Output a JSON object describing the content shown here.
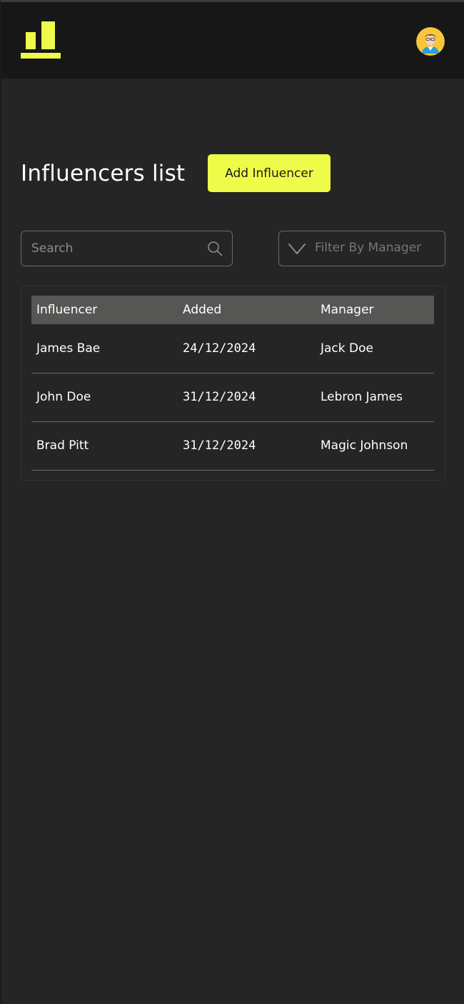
{
  "header": {
    "logo_icon": "bar-chart-logo-icon",
    "avatar_icon": "user-avatar-icon",
    "accent_color": "#eefb48"
  },
  "main": {
    "title": "Influencers list",
    "add_button_label": "Add Influencer",
    "search": {
      "placeholder": "Search",
      "value": "",
      "icon": "search-icon"
    },
    "filter": {
      "label": "Filter By Manager",
      "icon": "chevron-down-icon"
    },
    "table": {
      "columns": [
        "Influencer",
        "Added",
        "Manager"
      ],
      "rows": [
        {
          "influencer": "James Bae",
          "added": "24/12/2024",
          "manager": "Jack Doe"
        },
        {
          "influencer": "John Doe",
          "added": "31/12/2024",
          "manager": "Lebron James"
        },
        {
          "influencer": "Brad Pitt",
          "added": "31/12/2024",
          "manager": "Magic Johnson"
        }
      ]
    }
  }
}
